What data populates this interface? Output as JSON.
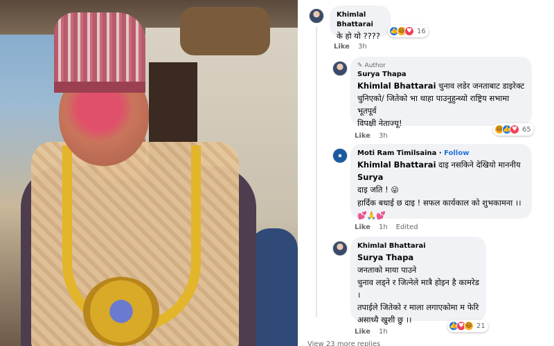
{
  "comments": [
    {
      "author": "Khimlal Bhattarai",
      "text": "के हो यो ????",
      "reaction_count": "16",
      "reactions": [
        "like",
        "haha",
        "love"
      ],
      "like_label": "Like",
      "time": "3h"
    },
    {
      "badge": "Author",
      "author": "Surya Thapa",
      "mention": "Khimlal Bhattarai",
      "text_line1": "चुनाव लडेर जनताबाट डाइरेक्ट",
      "text_line2": "चुनिएको/ जितेको भा थाहा पाउनुहुन्थ्यो राष्ट्रिय सभामा भूतपूर्व",
      "text_line3": "विपक्षी नेताज्यू!",
      "reaction_count": "65",
      "reactions": [
        "haha",
        "like",
        "love"
      ],
      "like_label": "Like",
      "time": "3h"
    },
    {
      "author": "Moti Ram Timilsaina",
      "follow_label": "Follow",
      "mention": "Khimlal Bhattarai",
      "text_line1": "दाइ नसकिने देखियो माननीय",
      "mention2": "Surya",
      "text_line2": "दाइ जति !",
      "text_line3": "हार्दिक बधाई छ दाइ ! सफल कार्यकाल को शुभकामना ।।",
      "emoji_line": "💕🙏💕",
      "emoji_inline": "😜",
      "like_label": "Like",
      "time": "1h",
      "edited": "Edited"
    },
    {
      "author": "Khimlal Bhattarai",
      "mention": "Surya Thapa",
      "text_line1": "जनताको माया पाउने",
      "text_line2": "चुनाव लड्ने र जित्नेले मात्रै होइन है कामरेड ।",
      "text_line3": "तपाईले जितेको र माला लगाएकोमा म फेरि",
      "text_line4": "असाध्यै खुशी छु ।।",
      "reaction_count": "21",
      "reactions": [
        "like",
        "love",
        "haha"
      ],
      "like_label": "Like",
      "time": "1h"
    }
  ],
  "footer_peek": "View 23 more replies"
}
